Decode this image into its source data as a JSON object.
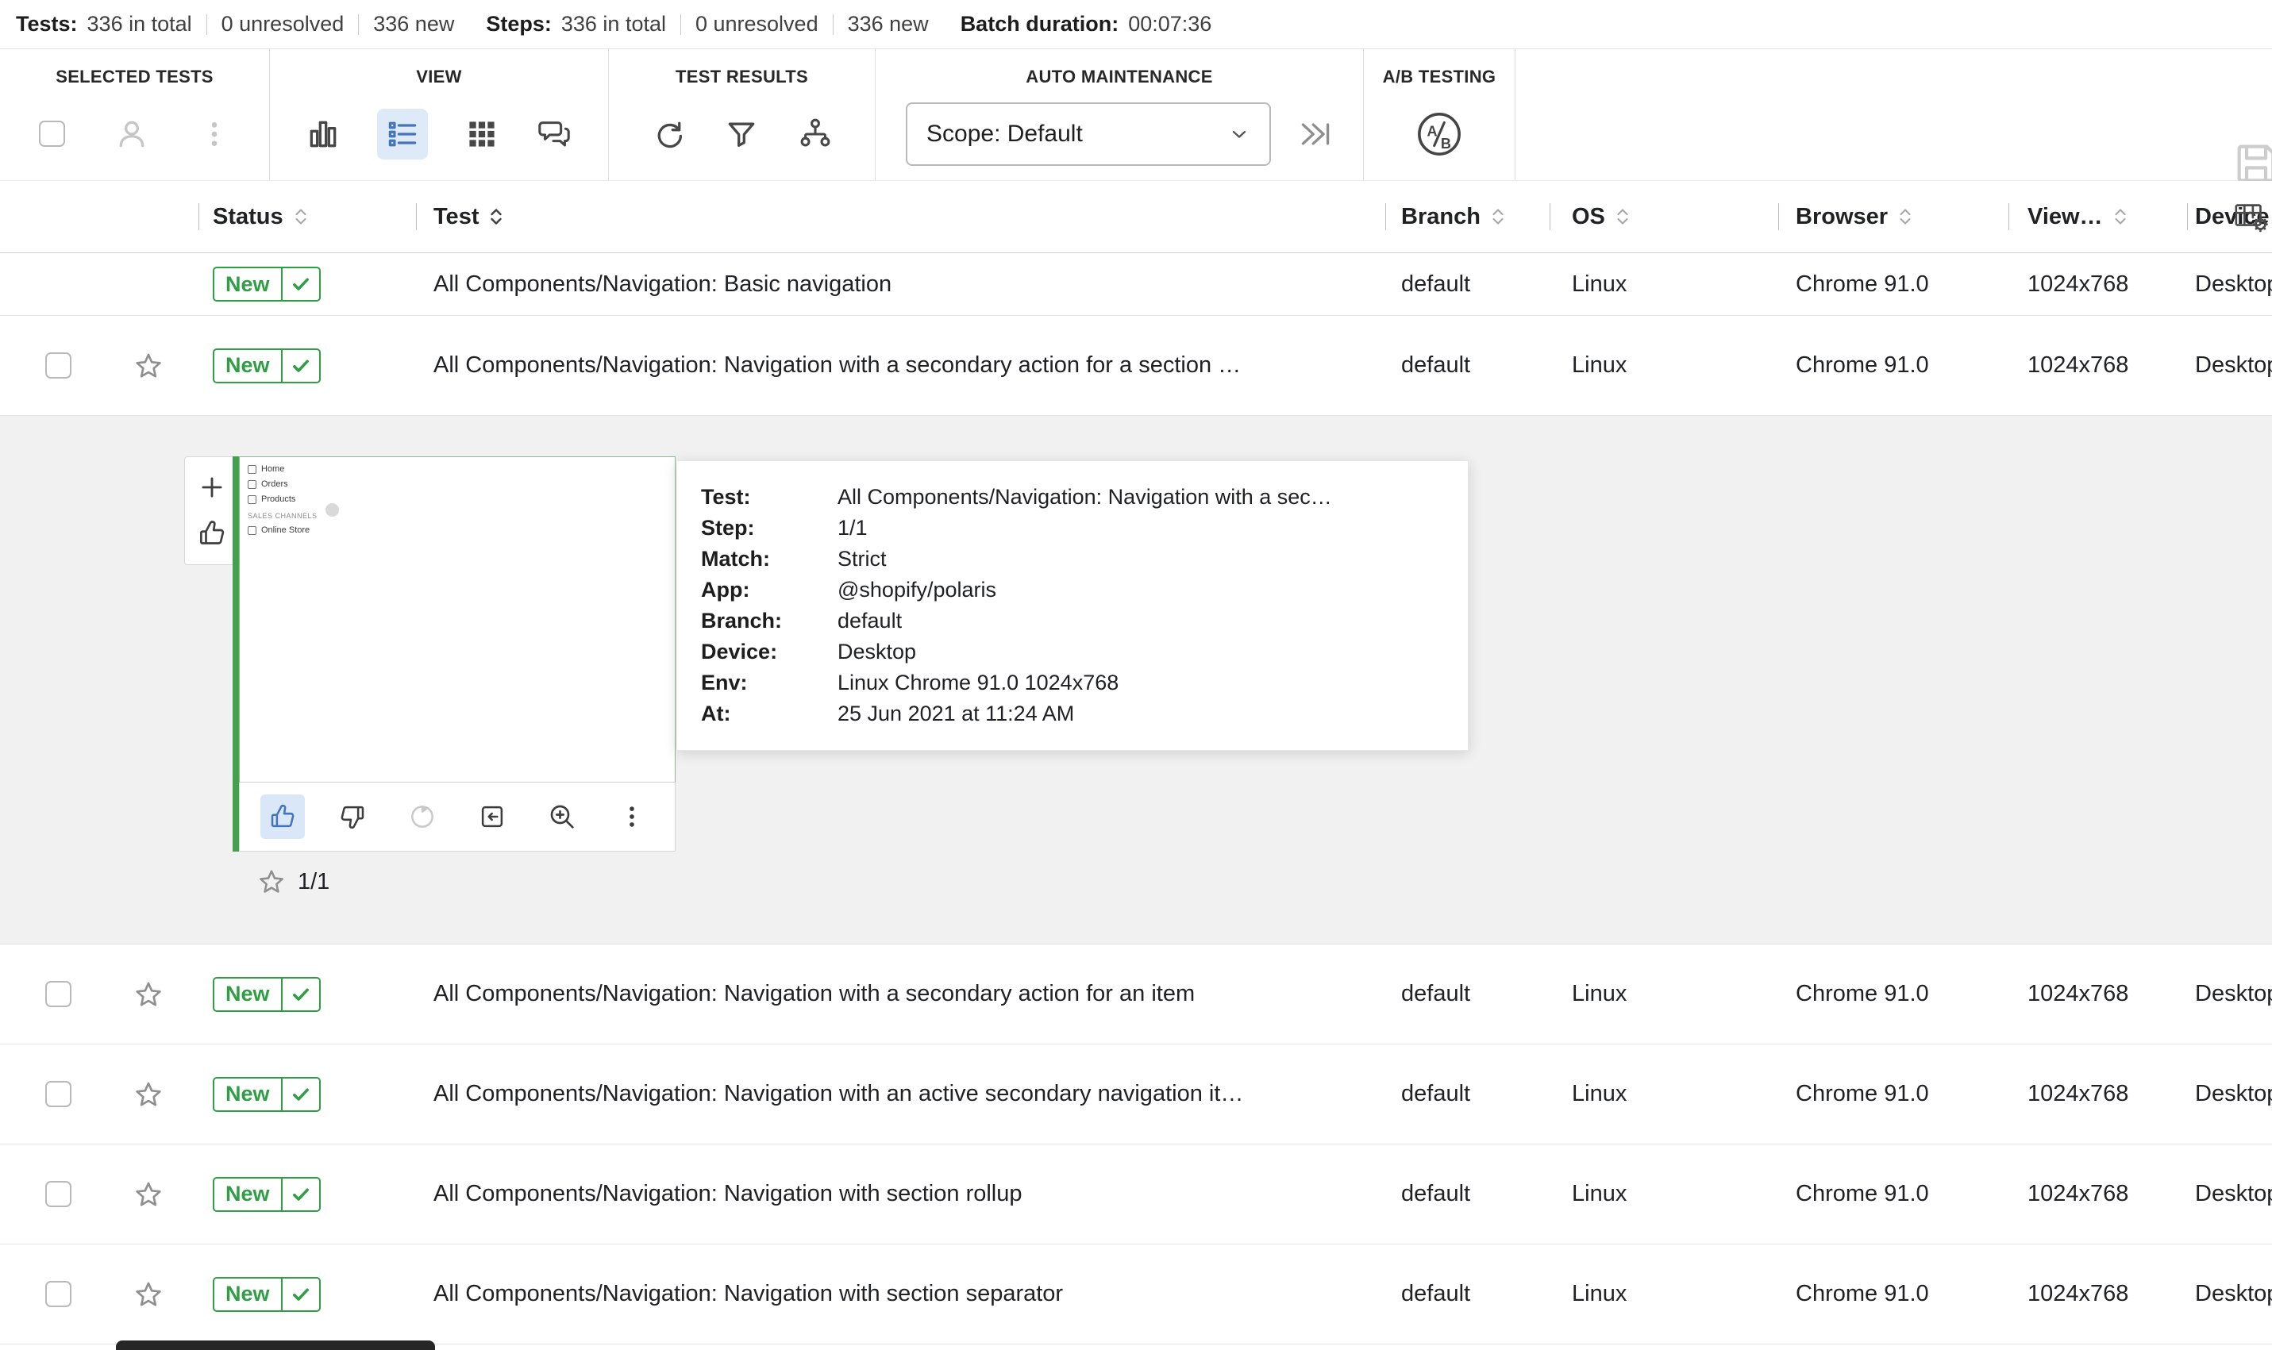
{
  "stats": {
    "tests_label": "Tests:",
    "tests_total": "336 in total",
    "tests_unresolved": "0 unresolved",
    "tests_new": "336 new",
    "steps_label": "Steps:",
    "steps_total": "336 in total",
    "steps_unresolved": "0 unresolved",
    "steps_new": "336 new",
    "duration_label": "Batch duration:",
    "duration_value": "00:07:36"
  },
  "toolbar": {
    "groups": {
      "selected_tests": {
        "label": "SELECTED TESTS"
      },
      "view": {
        "label": "VIEW"
      },
      "test_results": {
        "label": "TEST RESULTS"
      },
      "auto_maintenance": {
        "label": "AUTO MAINTENANCE",
        "scope_value": "Scope: Default"
      },
      "ab_testing": {
        "label": "A/B TESTING",
        "icon_text": "A/B"
      }
    }
  },
  "colors": {
    "badge_green": "#2f9e44",
    "selected_blue": "#4474b9",
    "selected_blue_bg": "#dfeaf9",
    "expanded_bg": "#f1f1f1",
    "thumbnail_green_bar": "#42a14e"
  },
  "table": {
    "headers": {
      "status": "Status",
      "test": "Test",
      "branch": "Branch",
      "os": "OS",
      "browser": "Browser",
      "viewport": "View…",
      "device": "Device"
    },
    "rows": [
      {
        "status": "New",
        "test": "All Components/Navigation: Basic navigation",
        "branch": "default",
        "os": "Linux",
        "browser": "Chrome 91.0",
        "viewport": "1024x768",
        "device": "Desktop"
      },
      {
        "status": "New",
        "test": "All Components/Navigation: Navigation with a secondary action for a section …",
        "branch": "default",
        "os": "Linux",
        "browser": "Chrome 91.0",
        "viewport": "1024x768",
        "device": "Desktop"
      },
      {
        "status": "New",
        "test": "All Components/Navigation: Navigation with a secondary action for an item",
        "branch": "default",
        "os": "Linux",
        "browser": "Chrome 91.0",
        "viewport": "1024x768",
        "device": "Desktop"
      },
      {
        "status": "New",
        "test": "All Components/Navigation: Navigation with an active secondary navigation it…",
        "branch": "default",
        "os": "Linux",
        "browser": "Chrome 91.0",
        "viewport": "1024x768",
        "device": "Desktop"
      },
      {
        "status": "New",
        "test": "All Components/Navigation: Navigation with section rollup",
        "branch": "default",
        "os": "Linux",
        "browser": "Chrome 91.0",
        "viewport": "1024x768",
        "device": "Desktop"
      },
      {
        "status": "New",
        "test": "All Components/Navigation: Navigation with section separator",
        "branch": "default",
        "os": "Linux",
        "browser": "Chrome 91.0",
        "viewport": "1024x768",
        "device": "Desktop"
      }
    ]
  },
  "expanded": {
    "step_indicator": "1/1",
    "thumbnail": {
      "items": [
        "Home",
        "Orders",
        "Products"
      ],
      "section": "SALES CHANNELS",
      "store": "Online Store"
    },
    "info": [
      {
        "label": "Test:",
        "value": "All Components/Navigation: Navigation with a sec…"
      },
      {
        "label": "Step:",
        "value": "1/1"
      },
      {
        "label": "Match:",
        "value": "Strict"
      },
      {
        "label": "App:",
        "value": "@shopify/polaris"
      },
      {
        "label": "Branch:",
        "value": "default"
      },
      {
        "label": "Device:",
        "value": "Desktop"
      },
      {
        "label": "Env:",
        "value": "Linux Chrome 91.0 1024x768"
      },
      {
        "label": "At:",
        "value": "25 Jun 2021 at 11:24 AM"
      }
    ]
  }
}
